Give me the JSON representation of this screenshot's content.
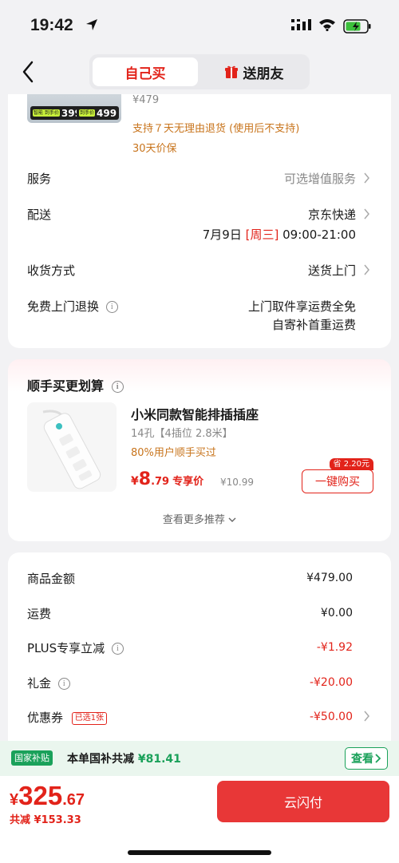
{
  "status_bar": {
    "time": "19:42"
  },
  "nav": {
    "tab_self": "自己买",
    "tab_gift": "送朋友"
  },
  "product": {
    "thumb_tag1_price": "399",
    "thumb_tag2_price": "499",
    "thumb_tag1_mini": "智能 到手价",
    "thumb_tag2_mini": "到手价",
    "price": "¥479",
    "return_policy": "支持７天无理由退货 (使用后不支持)",
    "price_protect": "30天价保"
  },
  "rows": {
    "service_label": "服务",
    "service_value": "可选增值服务",
    "delivery_label": "配送",
    "delivery_carrier": "京东快递",
    "delivery_date": "7月9日",
    "delivery_week": "[周三]",
    "delivery_time": "09:00-21:00",
    "receive_label": "收货方式",
    "receive_value": "送货上门",
    "free_return_label": "免费上门退换",
    "free_return_line1": "上门取件享运费全免",
    "free_return_line2": "自寄补首重运费"
  },
  "recommend": {
    "title": "顺手买更划算",
    "name": "小米同款智能排插插座",
    "spec": "14孔【4插位 2.8米】",
    "hint": "80%用户顺手买过",
    "price_symbol": "¥",
    "price_int": "8",
    "price_dec": ".79",
    "price_label": "专享价",
    "original_price": "¥10.99",
    "save_badge": "省 2.20元",
    "buy_button": "一键购买",
    "more": "查看更多推荐"
  },
  "totals": {
    "goods_label": "商品金额",
    "goods_value": "¥479.00",
    "shipping_label": "运费",
    "shipping_value": "¥0.00",
    "plus_label": "PLUS专享立减",
    "plus_value": "-¥1.92",
    "gift_label": "礼金",
    "gift_value": "-¥20.00",
    "coupon_label": "优惠券",
    "coupon_tag": "已选1张",
    "coupon_value": "-¥50.00"
  },
  "subsidy": {
    "tag": "国家补贴",
    "text": "本单国补共减",
    "amount": "¥81.41",
    "view_button": "查看"
  },
  "checkout": {
    "total_symbol": "¥",
    "total_int": "325",
    "total_dec": ".67",
    "discount": "共减 ¥153.33",
    "pay_button": "云闪付"
  },
  "colors": {
    "accent_red": "#e2231a",
    "green": "#1aa15a",
    "orange": "#c8741c"
  }
}
